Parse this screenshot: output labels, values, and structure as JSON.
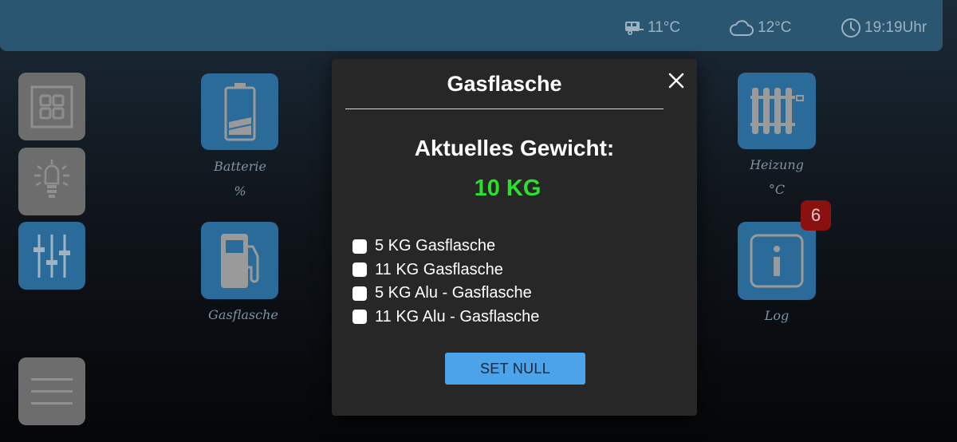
{
  "statusbar": {
    "outside_temp": "11°C",
    "weather_temp": "12°C",
    "time": "19:19Uhr"
  },
  "tiles": {
    "batterie": {
      "caption": "Batterie",
      "sub": "%"
    },
    "heizung": {
      "caption": "Heizung",
      "sub": "°C"
    },
    "gasflasche": {
      "caption": "Gasflasche"
    },
    "log": {
      "caption": "Log",
      "badge": "6"
    }
  },
  "modal": {
    "title": "Gasflasche",
    "label": "Aktuelles Gewicht:",
    "value": "10 KG",
    "value_color": "#2be12b",
    "options": [
      "5 KG Gasflasche",
      "11 KG Gasflasche",
      "5 KG Alu - Gasflasche",
      "11 KG Alu - Gasflasche"
    ],
    "button": "SET NULL"
  },
  "colors": {
    "topbar": "#2a5672",
    "accent": "#4ba3ea",
    "badge": "#8b1010"
  }
}
